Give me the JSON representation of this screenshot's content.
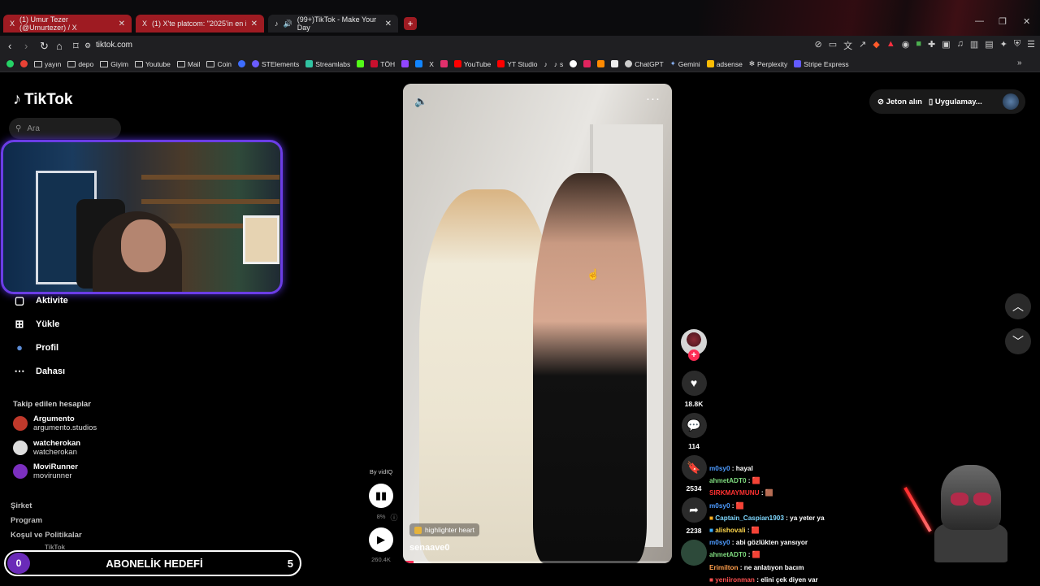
{
  "tabs": [
    {
      "icon": "X",
      "label": "(1) Umur Tezer (@Umurtezer) / X"
    },
    {
      "icon": "X",
      "label": "(1) X'te platcom: \"2025'in en iyi klibin"
    },
    {
      "icon": "♪",
      "label": "(99+)TikTok - Make Your Day"
    }
  ],
  "tab_close": "✕",
  "new_tab": "+",
  "address": {
    "url": "tiktok.com"
  },
  "bookmarks": [
    {
      "label": "yayın",
      "type": "folder"
    },
    {
      "label": "depo",
      "type": "folder"
    },
    {
      "label": "Giyim",
      "type": "folder"
    },
    {
      "label": "Youtube",
      "type": "folder"
    },
    {
      "label": "Mail",
      "type": "folder"
    },
    {
      "label": "Coin",
      "type": "folder"
    },
    {
      "label": "STElements",
      "type": "site",
      "color": "#6a5cff"
    },
    {
      "label": "Streamlabs",
      "type": "site",
      "color": "#31c3a2"
    },
    {
      "label": "TÖH",
      "type": "site",
      "color": "#c8102e"
    },
    {
      "label": "YouTube",
      "type": "site",
      "color": "#ff0000"
    },
    {
      "label": "YT Studio",
      "type": "site",
      "color": "#ff0000"
    },
    {
      "label": "s",
      "type": "site",
      "color": "#ffffff"
    },
    {
      "label": "ChatGPT",
      "type": "site",
      "color": "#cccccc"
    },
    {
      "label": "Gemini",
      "type": "site",
      "color": "#8ab4f8"
    },
    {
      "label": "adsense",
      "type": "site",
      "color": "#fbbc04"
    },
    {
      "label": "Perplexity",
      "type": "site",
      "color": "#cccccc"
    },
    {
      "label": "Stripe Express",
      "type": "site",
      "color": "#635bff"
    }
  ],
  "brand": {
    "name": "TikTok"
  },
  "search": {
    "placeholder": "Ara"
  },
  "nav": [
    {
      "label": "Aktivite",
      "icon": "activity-icon"
    },
    {
      "label": "Yükle",
      "icon": "upload-icon"
    },
    {
      "label": "Profil",
      "icon": "profile-icon"
    },
    {
      "label": "Dahası",
      "icon": "more-icon"
    }
  ],
  "following": {
    "heading": "Takip edilen hesaplar",
    "accounts": [
      {
        "name": "Argumento",
        "handle": "argumento.studios",
        "color": "#c0392b"
      },
      {
        "name": "watcherokan",
        "handle": "watcherokan",
        "color": "#dddddd"
      },
      {
        "name": "MoviRunner",
        "handle": "movirunner",
        "color": "#7b2fbf"
      }
    ]
  },
  "footer": [
    "Şirket",
    "Program",
    "Koşul ve Politikalar"
  ],
  "footer_partial": "TikTok",
  "goal": {
    "count": "0",
    "label": "ABONELİK HEDEFİ",
    "target": "5"
  },
  "video": {
    "username": "senaave0",
    "tag": "highlighter heart",
    "progress": 0.04
  },
  "vidiq": {
    "by": "By vidIQ",
    "percent": "8%",
    "views": "260.4K"
  },
  "actions": {
    "likes": "18.8K",
    "comments": "114",
    "saves": "2534",
    "shares": "2238"
  },
  "top_right": {
    "coins": "Jeton alın",
    "app": "Uygulamay..."
  },
  "chat": [
    {
      "user": "m0sy0",
      "color": "#4d9bff",
      "msg": "hayal"
    },
    {
      "user": "ahmetADT0",
      "color": "#7fdc7f",
      "msg": "🟥"
    },
    {
      "user": "SIRKMAYMUNU",
      "color": "#ff3030",
      "msg": "🟫"
    },
    {
      "user": "m0sy0",
      "color": "#4d9bff",
      "msg": "🟥"
    },
    {
      "user": "Captain_Caspian1903",
      "color": "#7fd8ff",
      "msg": "ya yeter ya"
    },
    {
      "user": "alishovali",
      "color": "#ffd84d",
      "msg": "🟥"
    },
    {
      "user": "m0sy0",
      "color": "#4d9bff",
      "msg": "abi gözlükten yansıyor"
    },
    {
      "user": "ahmetADT0",
      "color": "#7fdc7f",
      "msg": "🟥"
    },
    {
      "user": "Erimilton",
      "color": "#ff9f4d",
      "msg": "ne anlatıyon bacım"
    },
    {
      "user": "yeniironman",
      "color": "#ff5050",
      "msg": "elini çek diyen var"
    }
  ]
}
